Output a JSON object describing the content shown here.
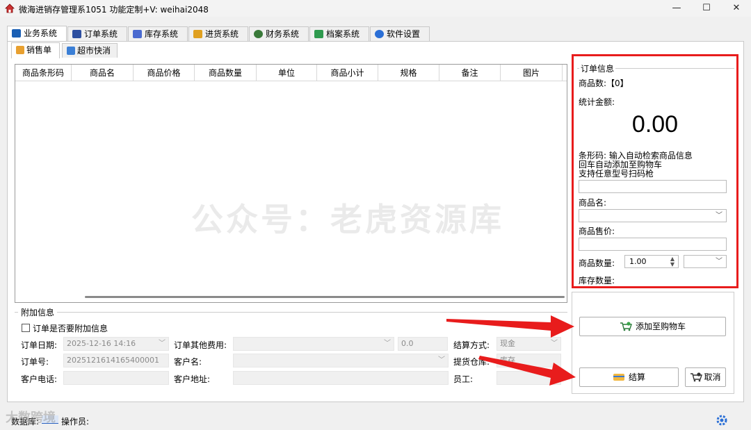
{
  "window": {
    "title": "微海进销存管理系1051  功能定制+V: weihai2048",
    "minimize": "—",
    "maximize": "☐",
    "close": "✕"
  },
  "tabs": [
    {
      "label": "业务系统",
      "icon": "business-icon",
      "color": "#1a5fb4"
    },
    {
      "label": "订单系统",
      "icon": "order-icon",
      "color": "#2d4fa0"
    },
    {
      "label": "库存系统",
      "icon": "inventory-icon",
      "color": "#4a6ad0"
    },
    {
      "label": "进货系统",
      "icon": "purchase-icon",
      "color": "#e0a020"
    },
    {
      "label": "财务系统",
      "icon": "finance-icon",
      "color": "#3a7a3a"
    },
    {
      "label": "档案系统",
      "icon": "archive-icon",
      "color": "#2e9a4e"
    },
    {
      "label": "软件设置",
      "icon": "settings-icon",
      "color": "#2b6fd6"
    }
  ],
  "subtabs": [
    {
      "label": "销售单",
      "icon": "sales-icon",
      "color": "#e8a030"
    },
    {
      "label": "超市快消",
      "icon": "supermarket-icon",
      "color": "#3b7fd6"
    }
  ],
  "grid": {
    "columns": [
      "商品条形码",
      "商品名",
      "商品价格",
      "商品数量",
      "单位",
      "商品小计",
      "规格",
      "备注",
      "图片"
    ]
  },
  "watermark": "公众号：老虎资源库",
  "extra": {
    "legend": "附加信息",
    "attach_checkbox": "订单是否要附加信息",
    "order_date_label": "订单日期:",
    "order_date_value": "2025-12-16 14:16",
    "other_fee_label": "订单其他费用:",
    "other_fee_value": "0.0",
    "pay_method_label": "结算方式:",
    "pay_method_value": "现金",
    "order_no_label": "订单号:",
    "order_no_value": "2025121614165400001",
    "customer_name_label": "客户名:",
    "warehouse_label": "提货仓库:",
    "warehouse_value": "库存",
    "customer_phone_label": "客户电话:",
    "customer_addr_label": "客户地址:",
    "staff_label": "员工:"
  },
  "order_info": {
    "legend": "订单信息",
    "count_label": "商品数:【0】",
    "total_label": "统计金额:",
    "total_value": "0.00",
    "barcode_hint_1": "条形码: 输入自动检索商品信息",
    "barcode_hint_2": "回车自动添加至购物车",
    "barcode_hint_3": "支持任意型号扫码枪",
    "name_label": "商品名:",
    "price_label": "商品售价:",
    "qty_label": "商品数量:",
    "qty_value": "1.00",
    "stock_label": "库存数量:"
  },
  "buttons": {
    "add_to_cart": "添加至购物车",
    "checkout": "结算",
    "cancel": "取消"
  },
  "status": {
    "db_label": "数据库:",
    "operator_label": "操作员:",
    "corner_watermark": "大数跨境"
  },
  "colors": {
    "highlight": "#e81c1c"
  }
}
